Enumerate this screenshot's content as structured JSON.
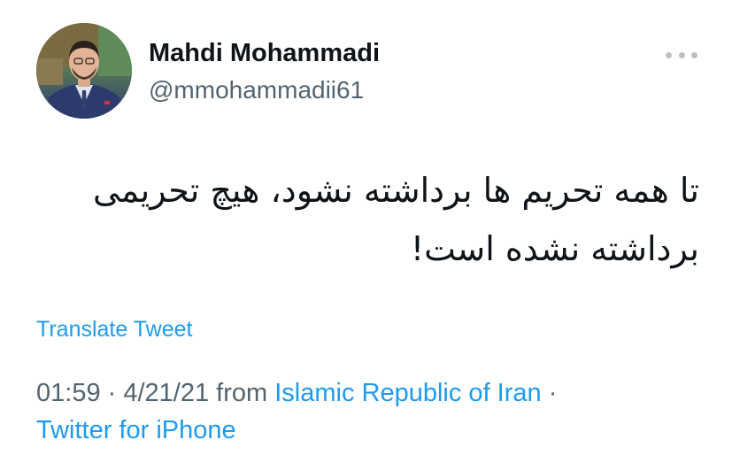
{
  "author": {
    "display_name": "Mahdi Mohammadi",
    "handle": "@mmohammadii61",
    "avatar_icon": "profile-photo"
  },
  "more_icon": "ellipsis-icon",
  "tweet": {
    "text_line1": "تا همه تحریم ها برداشته نشود، هیچ تحریمی",
    "text_line2": "برداشته نشده است!"
  },
  "translate_label": "Translate Tweet",
  "meta": {
    "time": "01:59",
    "sep1": " · ",
    "date": "4/21/21",
    "from_word": " from ",
    "location": "Islamic Republic of Iran",
    "sep2": " ·",
    "source": "Twitter for iPhone"
  },
  "colors": {
    "link": "#1d9bf0",
    "secondary_text": "#536471",
    "primary_text": "#0f1419"
  }
}
